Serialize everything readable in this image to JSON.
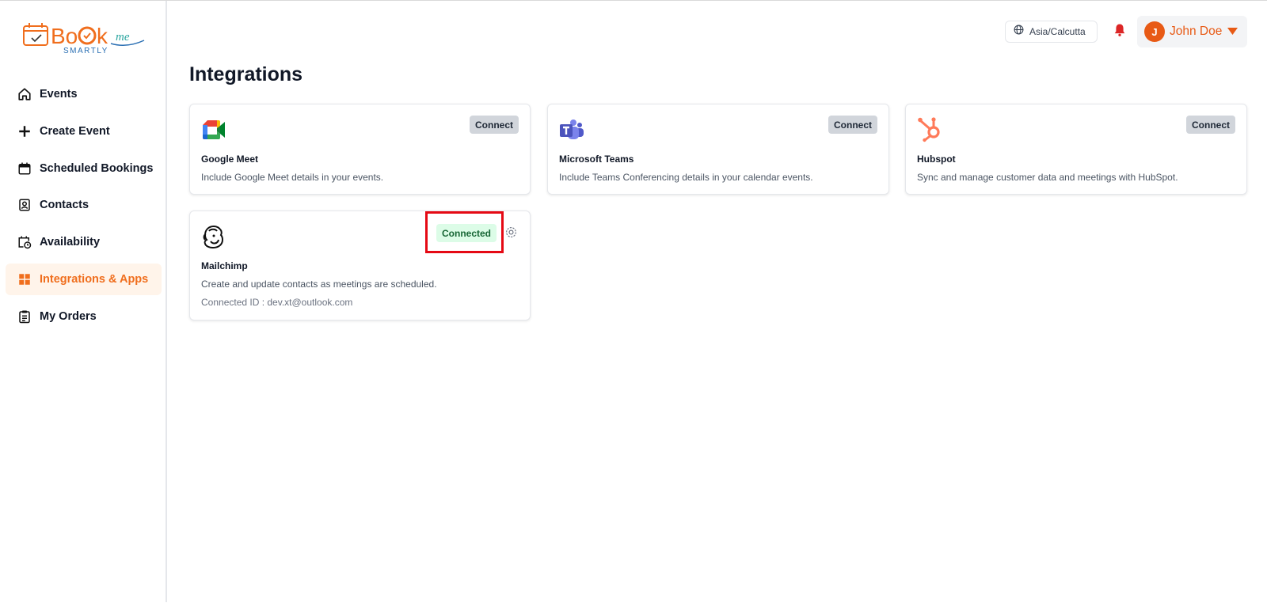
{
  "brand": {
    "logo_word": "Bo",
    "logo_word2": "k",
    "logo_me": "me",
    "logo_tagline": "SMARTLY"
  },
  "sidebar": {
    "items": [
      {
        "label": "Events",
        "icon": "home-icon",
        "active": false
      },
      {
        "label": "Create Event",
        "icon": "plus-icon",
        "active": false
      },
      {
        "label": "Scheduled Bookings",
        "icon": "calendar-icon",
        "active": false
      },
      {
        "label": "Contacts",
        "icon": "contact-card-icon",
        "active": false
      },
      {
        "label": "Availability",
        "icon": "calendar-clock-icon",
        "active": false
      },
      {
        "label": "Integrations & Apps",
        "icon": "grid-icon",
        "active": true
      },
      {
        "label": "My Orders",
        "icon": "clipboard-icon",
        "active": false
      }
    ]
  },
  "header": {
    "timezone": "Asia/Calcutta",
    "user_initial": "J",
    "user_name": "John Doe"
  },
  "main": {
    "title": "Integrations",
    "cards": [
      {
        "name": "Google Meet",
        "description": "Include Google Meet details in your events.",
        "action": "Connect",
        "icon": "google-meet-icon"
      },
      {
        "name": "Microsoft Teams",
        "description": "Include Teams Conferencing details in your calendar events.",
        "action": "Connect",
        "icon": "microsoft-teams-icon"
      },
      {
        "name": "Hubspot",
        "description": "Sync and manage customer data and meetings with HubSpot.",
        "action": "Connect",
        "icon": "hubspot-icon"
      },
      {
        "name": "Mailchimp",
        "description": "Create and update contacts as meetings are scheduled.",
        "status": "Connected",
        "connected_id": "Connected ID : dev.xt@outlook.com",
        "icon": "mailchimp-icon"
      }
    ]
  },
  "colors": {
    "accent": "#f06e1d",
    "active_bg": "#fff4ea",
    "connected_bg": "#dcfce7",
    "connected_text": "#166534",
    "highlight": "#e50914",
    "bell": "#dc2626"
  }
}
